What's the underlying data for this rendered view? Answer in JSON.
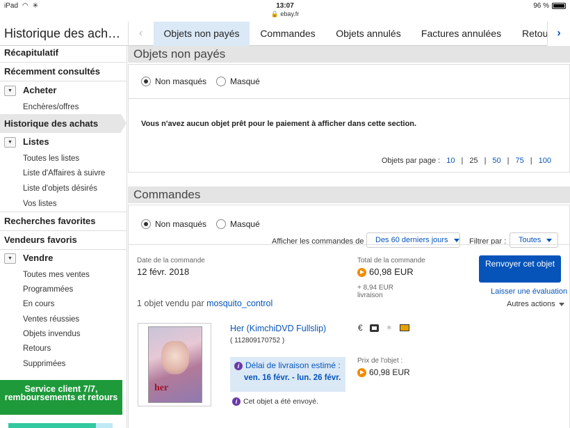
{
  "status_bar": {
    "device": "iPad",
    "time": "13:07",
    "url": "🔒 ebay.fr",
    "battery": "96 %"
  },
  "header": {
    "title": "Historique des ach…",
    "tabs": [
      {
        "label": "Objets non payés",
        "active": true
      },
      {
        "label": "Commandes"
      },
      {
        "label": "Objets annulés"
      },
      {
        "label": "Factures annulées"
      },
      {
        "label": "Retou"
      }
    ]
  },
  "sidebar": {
    "recap": "Récapitulatif",
    "recent": "Récemment consultés",
    "buy": "Acheter",
    "buy_items": [
      "Enchères/offres"
    ],
    "history": "Historique des achats",
    "lists": "Listes",
    "lists_items": [
      "Toutes les listes",
      "Liste d'Affaires à suivre",
      "Liste d'objets désirés",
      "Vos listes"
    ],
    "fav_searches": "Recherches favorites",
    "fav_sellers": "Vendeurs favoris",
    "sell": "Vendre",
    "sell_items": [
      "Toutes mes ventes",
      "Programmées",
      "En cours",
      "Ventes réussies",
      "Objets invendus",
      "Retours",
      "Supprimées"
    ],
    "promo": "Service client 7/7, remboursements et retours"
  },
  "unpaid": {
    "heading": "Objets non payés",
    "radio_visible": "Non masqués",
    "radio_hidden": "Masqué",
    "empty_message": "Vous n'avez aucun objet prêt pour le paiement à afficher dans cette section.",
    "per_page_label": "Objets par page :",
    "per_page_options": [
      "10",
      "25",
      "50",
      "75",
      "100"
    ]
  },
  "orders": {
    "heading": "Commandes",
    "radio_visible": "Non masqués",
    "radio_hidden": "Masqué",
    "show_label": "Afficher les commandes de :",
    "show_value": "Des 60 derniers jours",
    "filter_label": "Filtrer par :",
    "filter_value": "Toutes",
    "order": {
      "date_label": "Date de la commande",
      "date": "12 févr. 2018",
      "total_label": "Total de la commande",
      "total": "60,98 EUR",
      "shipping": "+ 8,94 EUR",
      "shipping_label": "livraison",
      "resend_button": "Renvoyer cet objet",
      "review_link": "Laisser une évaluation",
      "more_actions": "Autres actions",
      "sold_by_prefix": "1 objet vendu par",
      "seller": "mosquito_control",
      "item": {
        "title": "Her (KimchiDVD Fullslip)",
        "id": "( 112809170752 )",
        "cover_text": "her",
        "delivery_label": "Délai de livraison estimé :",
        "delivery_dates": "ven. 16 févr. - lun. 26 févr.",
        "sent_status": "Cet objet a été envoyé.",
        "icon_currency": "€",
        "price_label": "Prix de l'objet :",
        "price": "60,98 EUR"
      }
    }
  }
}
